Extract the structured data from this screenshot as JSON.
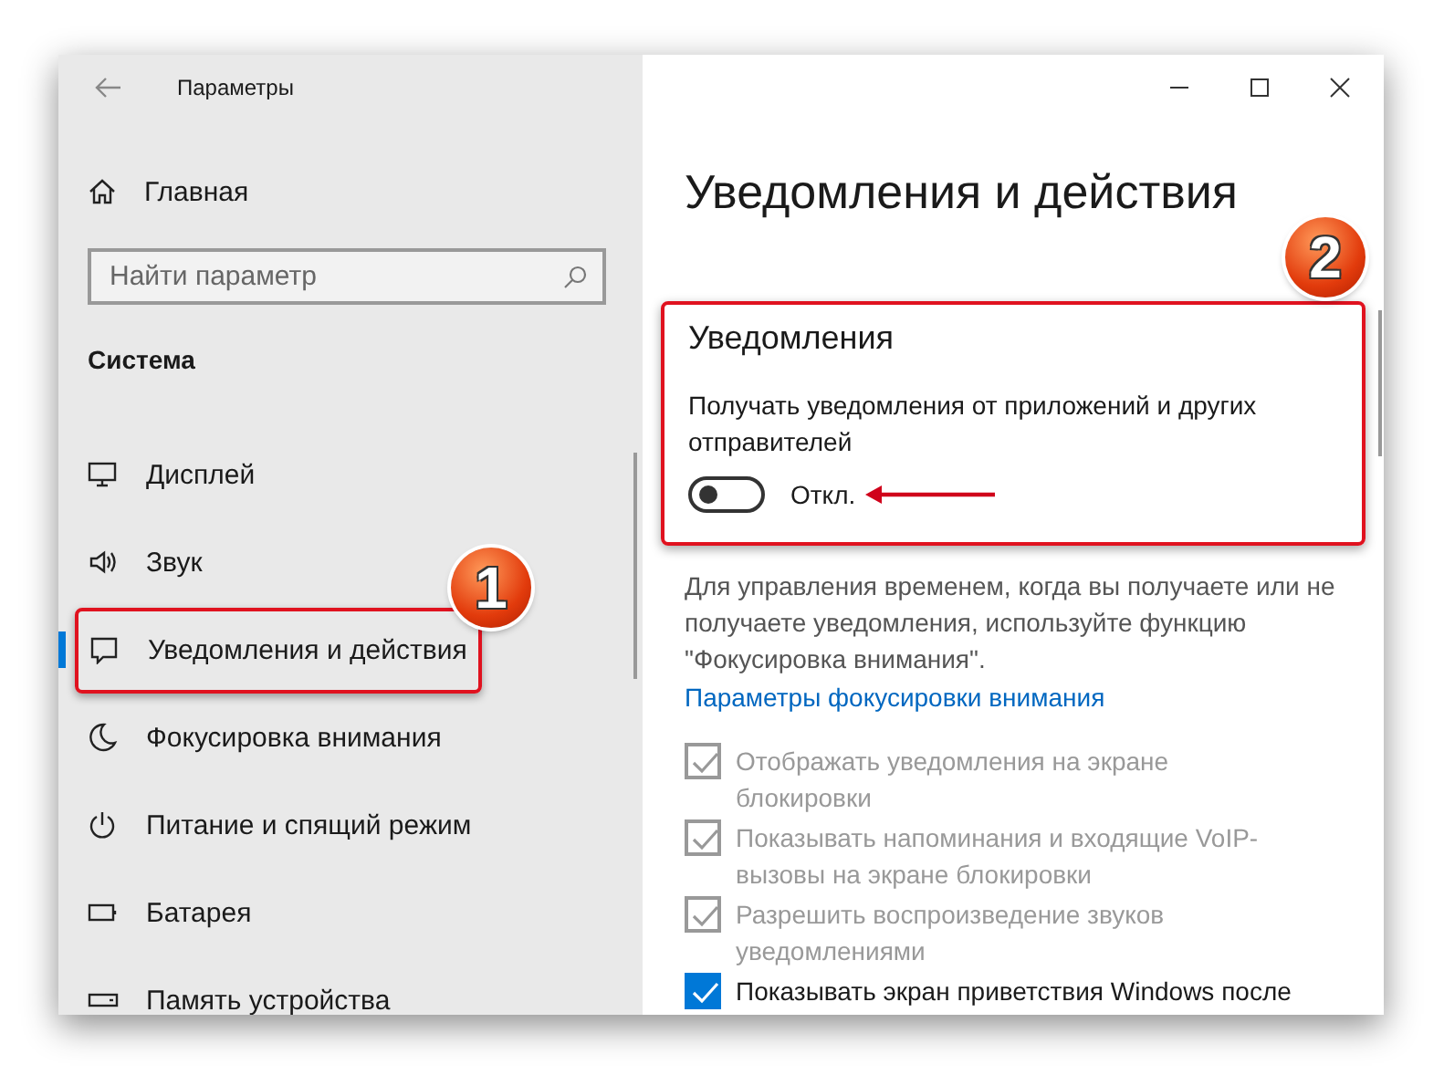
{
  "window": {
    "title": "Параметры"
  },
  "sidebar": {
    "home": "Главная",
    "search": {
      "placeholder": "Найти параметр"
    },
    "group": "Система",
    "items": [
      {
        "label": "Дисплей",
        "selected": false,
        "highlighted": false
      },
      {
        "label": "Звук",
        "selected": false,
        "highlighted": false
      },
      {
        "label": "Уведомления и действия",
        "selected": true,
        "highlighted": true,
        "badge": "1"
      },
      {
        "label": "Фокусировка внимания",
        "selected": false,
        "highlighted": false
      },
      {
        "label": "Питание и спящий режим",
        "selected": false,
        "highlighted": false
      },
      {
        "label": "Батарея",
        "selected": false,
        "highlighted": false
      },
      {
        "label": "Память устройства",
        "selected": false,
        "highlighted": false
      }
    ]
  },
  "page": {
    "heading": "Уведомления и действия",
    "section": {
      "title": "Уведомления",
      "highlighted": true,
      "badge": "2",
      "description": "Получать уведомления от приложений и других отправителей",
      "toggle": {
        "on": false,
        "label": "Откл.",
        "arrow": true
      }
    },
    "info": "Для управления временем, когда вы получаете или не получаете уведомления, используйте функцию \"Фокусировка внимания\".",
    "link": "Параметры фокусировки внимания",
    "options": [
      {
        "label": "Отображать уведомления на экране блокировки",
        "checked": true,
        "disabled": true
      },
      {
        "label": "Показывать напоминания и входящие VoIP-вызовы на экране блокировки",
        "checked": true,
        "disabled": true
      },
      {
        "label": "Разрешить  воспроизведение звуков уведомлениями",
        "checked": true,
        "disabled": true
      },
      {
        "label": "Показывать экран приветствия Windows после",
        "checked": true,
        "disabled": false
      }
    ]
  }
}
